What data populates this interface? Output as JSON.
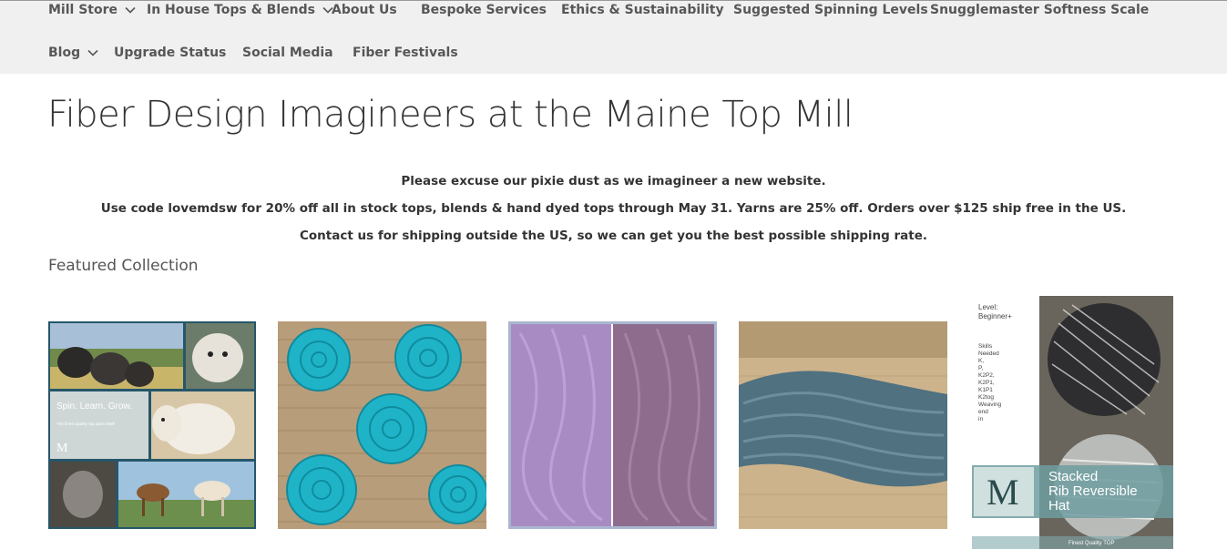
{
  "nav": {
    "row1": [
      {
        "label": "Mill Store",
        "has_dropdown": true
      },
      {
        "label": "In House Tops & Blends",
        "has_dropdown": true
      },
      {
        "label": "About Us",
        "has_dropdown": false
      },
      {
        "label": "Bespoke Services",
        "has_dropdown": false
      },
      {
        "label": "Ethics & Sustainability",
        "has_dropdown": false
      },
      {
        "label": "Suggested Spinning Levels",
        "has_dropdown": false
      },
      {
        "label": "Snugglemaster Softness Scale",
        "has_dropdown": false
      }
    ],
    "row2": [
      {
        "label": "Blog",
        "has_dropdown": true
      },
      {
        "label": "Upgrade Status",
        "has_dropdown": false
      },
      {
        "label": "Social Media",
        "has_dropdown": false
      },
      {
        "label": "Fiber Festivals",
        "has_dropdown": false
      }
    ]
  },
  "page": {
    "title": "Fiber Design Imagineers at the Maine Top Mill",
    "notices": [
      "Please excuse our pixie dust as we imagineer a new website.",
      "Use code lovemdsw for 20% off all in stock tops, blends & hand dyed tops through May 31. Yarns are 25% off. Orders over $125 ship free in the US.",
      "Contact us for shipping outside the US, so we can get you the best possible shipping rate."
    ],
    "featured_heading": "Featured Collection"
  },
  "collection": {
    "tile1": {
      "overlay_title": "Spin. Learn. Grow.",
      "overlay_sub": "The finest quality top spins itself",
      "monogram": "M"
    },
    "tile5": {
      "level_label": "Level:",
      "level_value": "Beginner+",
      "skills_lines": [
        "Skills",
        "Needed",
        "K,",
        "P,",
        "K2P2,",
        "K2P1,",
        "K1P1",
        "K2tog",
        "Weaving",
        "end",
        "in"
      ],
      "monogram": "M",
      "title_lines": [
        "Stacked",
        "Rib Reversible",
        "Hat"
      ],
      "footer": "Finest  Quality  TOP"
    }
  },
  "colors": {
    "nav_bg": "#f0f0f0",
    "nav_text": "#575757",
    "body_text": "#333333",
    "turquoise": "#1fb3c8",
    "lavender": "#a98bc4",
    "slate_yarn": "#4f7180"
  }
}
